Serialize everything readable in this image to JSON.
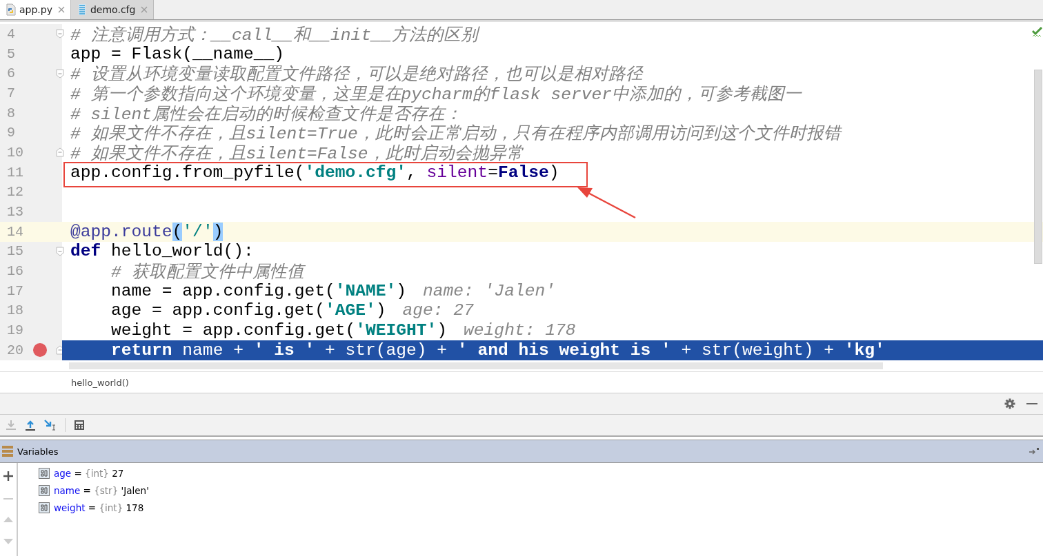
{
  "tabs": [
    {
      "label": "app.py",
      "kind": "python",
      "selected": true
    },
    {
      "label": "demo.cfg",
      "kind": "config",
      "selected": false
    }
  ],
  "editor": {
    "lines": [
      {
        "number": "4",
        "fold_start": true,
        "tokens": [
          {
            "text": "# 注意调用方式：__call__和__init__方法的区别",
            "kind": "comment"
          }
        ]
      },
      {
        "number": "5",
        "tokens": [
          {
            "text": "app = Flask(__name__)",
            "kind": "plain"
          }
        ]
      },
      {
        "number": "6",
        "fold_start": true,
        "tokens": [
          {
            "text": "# 设置从环境变量读取配置文件路径，可以是绝对路径，也可以是相对路径",
            "kind": "comment"
          }
        ]
      },
      {
        "number": "7",
        "tokens": [
          {
            "text": "# 第一个参数指向这个环境变量，这里是在pycharm的flask server中添加的，可参考截图一",
            "kind": "comment"
          }
        ]
      },
      {
        "number": "8",
        "tokens": [
          {
            "text": "# silent属性会在启动的时候检查文件是否存在：",
            "kind": "comment"
          }
        ]
      },
      {
        "number": "9",
        "tokens": [
          {
            "text": "# 如果文件不存在，且silent=True，此时会正常启动，只有在程序内部调用访问到这个文件时报错",
            "kind": "comment"
          }
        ]
      },
      {
        "number": "10",
        "fold_end": true,
        "tokens": [
          {
            "text": "# 如果文件不存在，且silent=False，此时启动会抛异常",
            "kind": "comment"
          }
        ]
      },
      {
        "number": "11",
        "annotated": true,
        "tokens": [
          {
            "text": "app.config.from_pyfile(",
            "kind": "plain"
          },
          {
            "text": "'demo.cfg'",
            "kind": "string"
          },
          {
            "text": ", ",
            "kind": "plain"
          },
          {
            "text": "silent",
            "kind": "param"
          },
          {
            "text": "=",
            "kind": "plain"
          },
          {
            "text": "False",
            "kind": "keyword"
          },
          {
            "text": ")",
            "kind": "plain"
          }
        ]
      },
      {
        "number": "12"
      },
      {
        "number": "13"
      },
      {
        "number": "14",
        "caret": true,
        "tokens": [
          {
            "text": "@app.route",
            "kind": "decorator"
          },
          {
            "text": "(",
            "kind": "match"
          },
          {
            "text": "'/'",
            "kind": "plainstring"
          },
          {
            "text": ")",
            "kind": "match"
          }
        ]
      },
      {
        "number": "15",
        "fold_start": true,
        "tokens": [
          {
            "text": "def",
            "kind": "keyword"
          },
          {
            "text": " hello_world():",
            "kind": "plain"
          }
        ]
      },
      {
        "number": "16",
        "tokens": [
          {
            "text": "    # 获取配置文件中属性值",
            "kind": "comment"
          }
        ]
      },
      {
        "number": "17",
        "hint": "name: 'Jalen'",
        "tokens": [
          {
            "text": "    name = app.config.get(",
            "kind": "plain"
          },
          {
            "text": "'NAME'",
            "kind": "string"
          },
          {
            "text": ")",
            "kind": "plain"
          }
        ]
      },
      {
        "number": "18",
        "hint": "age: 27",
        "tokens": [
          {
            "text": "    age = app.config.get(",
            "kind": "plain"
          },
          {
            "text": "'AGE'",
            "kind": "string"
          },
          {
            "text": ")",
            "kind": "plain"
          }
        ]
      },
      {
        "number": "19",
        "hint": "weight: 178",
        "tokens": [
          {
            "text": "    weight = app.config.get(",
            "kind": "plain"
          },
          {
            "text": "'WEIGHT'",
            "kind": "string"
          },
          {
            "text": ")",
            "kind": "plain"
          }
        ]
      },
      {
        "number": "20",
        "breakpoint": true,
        "execution": true,
        "fold_end": true,
        "tokens": [
          {
            "text": "    return",
            "kind": "keyword"
          },
          {
            "text": " name + ",
            "kind": "plain"
          },
          {
            "text": "' is '",
            "kind": "string"
          },
          {
            "text": " + str(age) + ",
            "kind": "plain"
          },
          {
            "text": "' and his weight is '",
            "kind": "string"
          },
          {
            "text": " + str(weight) + ",
            "kind": "plain"
          },
          {
            "text": "'kg'",
            "kind": "string"
          }
        ]
      }
    ]
  },
  "breadcrumb": "hello_world()",
  "variables": {
    "title": "Variables",
    "items": [
      {
        "name": "age",
        "separator": "=",
        "type": "{int}",
        "value": "27"
      },
      {
        "name": "name",
        "separator": "=",
        "type": "{str}",
        "value": "'Jalen'"
      },
      {
        "name": "weight",
        "separator": "=",
        "type": "{int}",
        "value": "178"
      }
    ]
  }
}
